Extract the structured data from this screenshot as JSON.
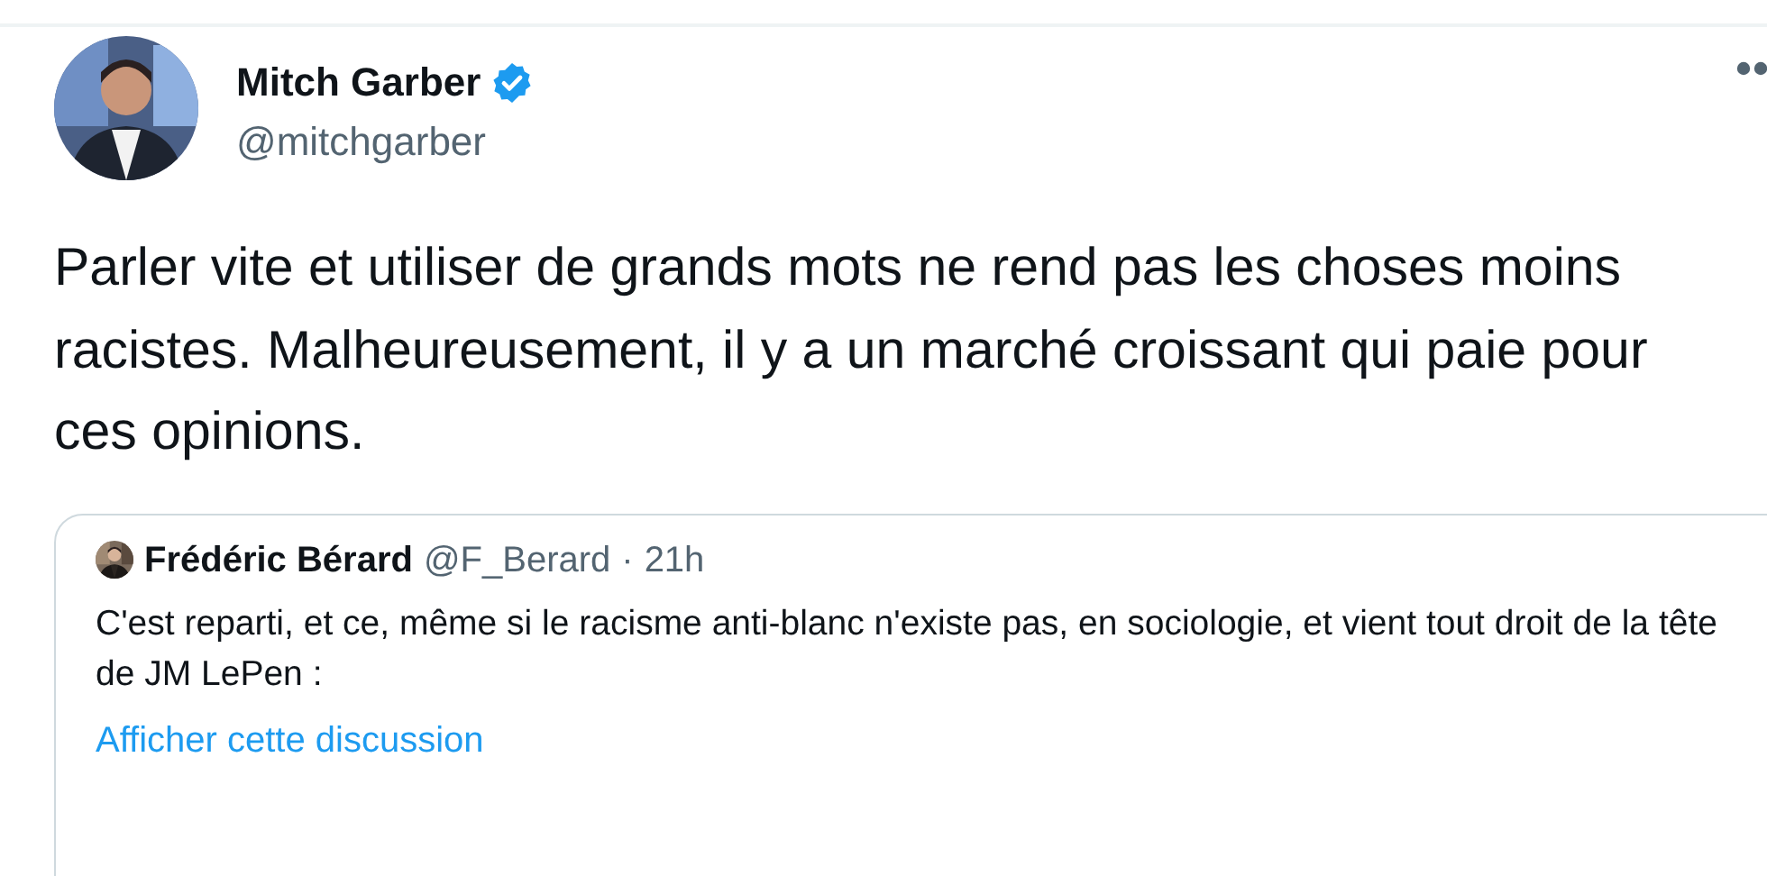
{
  "author": {
    "name": "Mitch Garber",
    "handle": "@mitchgarber",
    "verified": true
  },
  "text": "Parler vite et utiliser de grands mots ne rend pas les choses moins racistes. Malheureusement, il y a un marché croissant qui paie pour ces opinions.",
  "quoted_tweet": {
    "author": {
      "name": "Frédéric Bérard",
      "handle": "@F_Berard"
    },
    "separator": "·",
    "time": "21h",
    "text": "C'est reparti, et ce, même si le racisme anti-blanc n'existe pas, en sociologie, et vient tout droit de la tête de JM LePen :",
    "link": "Afficher cette discussion"
  }
}
